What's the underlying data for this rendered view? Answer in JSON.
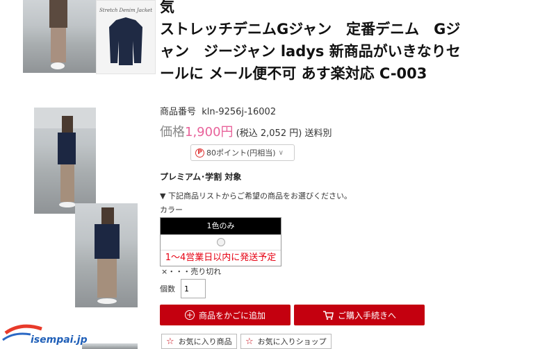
{
  "title_top": "気",
  "product_title": "ストレッチデニムGジャン　定番デニム　Gジャン　ジージャン ladys 新商品がいきなりセールに メール便不可 あす楽対応 C-003",
  "code_label": "商品番号",
  "code_value": "kln-9256j-16002",
  "price_label": "価格",
  "price_value": "1,900円",
  "price_tax": "(税込 2,052 円)",
  "shipping": "送料別",
  "points_icon": "P",
  "points_text": "80ポイント(円相当)",
  "premium_text": "プレミアム･学割 対象",
  "note_text": "▼ 下記商品リストからご希望の商品をお選びください。",
  "color_label": "カラー",
  "variant": {
    "header": "1色のみ",
    "shipping_note": "1～4営業日以内に発送予定"
  },
  "soldout_legend": "×・・・売り切れ",
  "qty_label": "個数",
  "qty_value": "1",
  "buttons": {
    "add_cart": "商品をかごに追加",
    "checkout": "ご購入手続きへ",
    "fav_item": "お気に入り商品",
    "fav_shop": "お気に入りショップ"
  },
  "jacket_caption": "Stretch Denim Jacket",
  "logo_text": "isempai.jp",
  "colors": {
    "accent_red": "#c4000f",
    "price_pink": "#e8629a",
    "ship_red": "#e60012"
  }
}
